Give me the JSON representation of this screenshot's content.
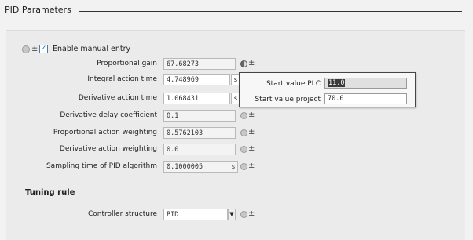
{
  "section": {
    "title": "PID Parameters"
  },
  "manual_entry": {
    "label": "Enable manual entry",
    "checked": true
  },
  "params": [
    {
      "label": "Proportional gain",
      "value": "67.68273",
      "unit": ""
    },
    {
      "label": "Integral action time",
      "value": "4.748969",
      "unit": "s"
    },
    {
      "label": "Derivative action time",
      "value": "1.068431",
      "unit": "s"
    },
    {
      "label": "Derivative delay coefficient",
      "value": "0.1",
      "unit": ""
    },
    {
      "label": "Proportional action weighting",
      "value": "0.5762103",
      "unit": ""
    },
    {
      "label": "Derivative action weighting",
      "value": "0.0",
      "unit": ""
    },
    {
      "label": "Sampling time of PID algorithm",
      "value": "0.1000005",
      "unit": "s"
    }
  ],
  "popup": {
    "plc_label": "Start value PLC",
    "plc_value": "11.0",
    "project_label": "Start value project",
    "project_value": "70.0"
  },
  "tuning": {
    "title": "Tuning rule",
    "structure_label": "Controller structure",
    "structure_value": "PID"
  },
  "icons": {
    "status": "status-dot-icon",
    "compare": "plus-minus-icon",
    "checkbox": "checkbox-icon",
    "dropdown": "chevron-down-icon"
  }
}
